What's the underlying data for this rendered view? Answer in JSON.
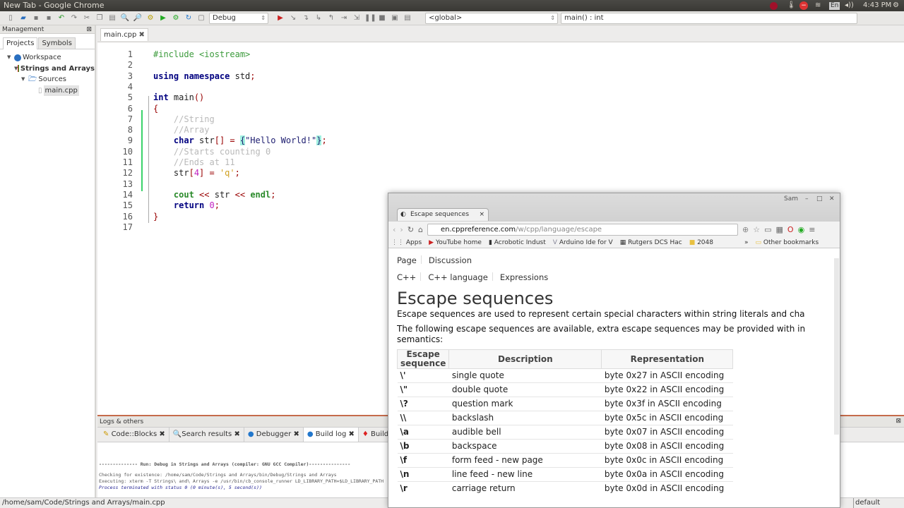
{
  "window_title": "New Tab - Google Chrome",
  "indicators": {
    "lang": "En",
    "volume": "◂))",
    "time": "4:43 PM"
  },
  "toolbar": {
    "build_target": "Debug",
    "scope": "<global>",
    "function": "main() : int"
  },
  "management": {
    "title": "Management",
    "tabs": [
      "Projects",
      "Symbols"
    ],
    "tree": {
      "workspace": "Workspace",
      "project": "Strings and Arrays",
      "folder": "Sources",
      "file": "main.cpp"
    }
  },
  "editor": {
    "tab": "main.cpp",
    "lines": [
      [
        {
          "t": "#include <iostream>",
          "k": "pre"
        }
      ],
      [],
      [
        {
          "t": "using namespace ",
          "k": "keyword"
        },
        {
          "t": "std",
          "k": "plain"
        },
        {
          "t": ";",
          "k": "op"
        }
      ],
      [],
      [
        {
          "t": "int ",
          "k": "keyword"
        },
        {
          "t": "main",
          "k": "plain"
        },
        {
          "t": "()",
          "k": "op"
        }
      ],
      [
        {
          "t": "{",
          "k": "op"
        }
      ],
      [
        {
          "t": "    //String",
          "k": "comment"
        }
      ],
      [
        {
          "t": "    //Array",
          "k": "comment"
        }
      ],
      [
        {
          "t": "    ",
          "k": "plain"
        },
        {
          "t": "char ",
          "k": "keyword"
        },
        {
          "t": "str",
          "k": "plain"
        },
        {
          "t": "[] = ",
          "k": "op"
        },
        {
          "t": "{",
          "k": "brace"
        },
        {
          "t": "\"Hello World!\"",
          "k": "str"
        },
        {
          "t": "}",
          "k": "brace"
        },
        {
          "t": ";",
          "k": "op"
        }
      ],
      [
        {
          "t": "    //Starts counting 0",
          "k": "comment"
        }
      ],
      [
        {
          "t": "    //Ends at 11",
          "k": "comment"
        }
      ],
      [
        {
          "t": "    str",
          "k": "plain"
        },
        {
          "t": "[",
          "k": "op"
        },
        {
          "t": "4",
          "k": "num"
        },
        {
          "t": "] = ",
          "k": "op"
        },
        {
          "t": "'q'",
          "k": "chr"
        },
        {
          "t": ";",
          "k": "op"
        }
      ],
      [],
      [
        {
          "t": "    ",
          "k": "plain"
        },
        {
          "t": "cout",
          "k": "std"
        },
        {
          "t": " << ",
          "k": "op"
        },
        {
          "t": "str",
          "k": "plain"
        },
        {
          "t": " << ",
          "k": "op"
        },
        {
          "t": "endl",
          "k": "std"
        },
        {
          "t": ";",
          "k": "op"
        }
      ],
      [
        {
          "t": "    ",
          "k": "plain"
        },
        {
          "t": "return ",
          "k": "keyword"
        },
        {
          "t": "0",
          "k": "num"
        },
        {
          "t": ";",
          "k": "op"
        }
      ],
      [
        {
          "t": "}",
          "k": "op"
        }
      ],
      []
    ]
  },
  "logs": {
    "title": "Logs & others",
    "tabs": [
      "Code::Blocks",
      "Search results",
      "Debugger",
      "Build log",
      "Build mess"
    ],
    "output": [
      "-------------- Run: Debug in Strings and Arrays (compiler: GNU GCC Compiler)---------------",
      "Checking for existence: /home/sam/Code/Strings and Arrays/bin/Debug/Strings and Arrays",
      "Executing: xterm -T Strings\\ and\\ Arrays -e /usr/bin/cb_console_runner LD_LIBRARY_PATH=$LD_LIBRARY_PATH",
      "Process terminated with status 0 (0 minute(s), 5 second(s))"
    ]
  },
  "statusbar": {
    "path": "/home/sam/Code/Strings and Arrays/main.cpp",
    "right": "default"
  },
  "chrome": {
    "tab_title": "Escape sequences",
    "user": "Sam",
    "url_host": "en.cppreference.com",
    "url_path": "/w/cpp/language/escape",
    "bookmarks": [
      "Apps",
      "YouTube home",
      "Acrobotic Indust",
      "Arduino Ide for V",
      "Rutgers DCS Hac",
      "2048",
      "»",
      "Other bookmarks"
    ],
    "page_tabs": [
      "Page",
      "Discussion"
    ],
    "breadcrumbs": [
      "C++",
      "C++ language",
      "Expressions"
    ],
    "heading": "Escape sequences",
    "para1": "Escape sequences are used to represent certain special characters within string literals and cha",
    "para2": "The following escape sequences are available, extra escape sequences may be provided with in",
    "para3": "semantics:",
    "table_headers": [
      "Escape sequence",
      "Description",
      "Representation"
    ],
    "table_rows": [
      [
        "\\'",
        "single quote",
        "byte 0x27 in ASCII encoding"
      ],
      [
        "\\\"",
        "double quote",
        "byte 0x22 in ASCII encoding"
      ],
      [
        "\\?",
        "question mark",
        "byte 0x3f in ASCII encoding"
      ],
      [
        "\\\\",
        "backslash",
        "byte 0x5c in ASCII encoding"
      ],
      [
        "\\a",
        "audible bell",
        "byte 0x07 in ASCII encoding"
      ],
      [
        "\\b",
        "backspace",
        "byte 0x08 in ASCII encoding"
      ],
      [
        "\\f",
        "form feed - new page",
        "byte 0x0c in ASCII encoding"
      ],
      [
        "\\n",
        "line feed - new line",
        "byte 0x0a in ASCII encoding"
      ],
      [
        "\\r",
        "carriage return",
        "byte 0x0d in ASCII encoding"
      ]
    ]
  }
}
